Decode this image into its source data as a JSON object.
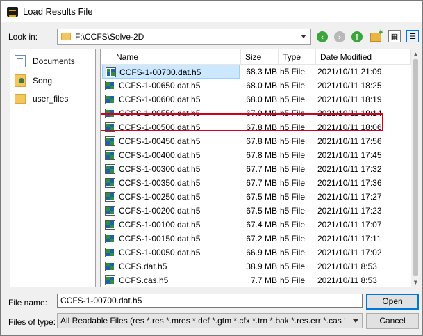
{
  "window": {
    "title": "Load Results File"
  },
  "lookin": {
    "label": "Look in:",
    "path": "F:\\CCFS\\Solve-2D"
  },
  "toolbar": {
    "back_icon": "back-arrow-icon",
    "forward_icon": "forward-arrow-icon",
    "up_icon": "up-arrow-icon",
    "new_folder_icon": "new-folder-icon",
    "list_view_icon": "list-view-icon",
    "detail_view_icon": "detail-view-icon"
  },
  "sidebar": {
    "items": [
      {
        "label": "Documents",
        "icon": "documents-icon"
      },
      {
        "label": "Song",
        "icon": "user-folder-icon"
      },
      {
        "label": "user_files",
        "icon": "folder-icon"
      }
    ]
  },
  "filelist": {
    "columns": [
      "Name",
      "Size",
      "Type",
      "Date Modified"
    ],
    "rows": [
      {
        "name": "CCFS-1-00700.dat.h5",
        "size": "68.3 MB",
        "type": "h5 File",
        "date": "2021/10/11 21:09",
        "selected": true
      },
      {
        "name": "CCFS-1-00650.dat.h5",
        "size": "68.0 MB",
        "type": "h5 File",
        "date": "2021/10/11 18:25"
      },
      {
        "name": "CCFS-1-00600.dat.h5",
        "size": "68.0 MB",
        "type": "h5 File",
        "date": "2021/10/11 18:19"
      },
      {
        "name": "CCFS-1-00550.dat.h5",
        "size": "67.9 MB",
        "type": "h5 File",
        "date": "2021/10/11 18:14"
      },
      {
        "name": "CCFS-1-00500.dat.h5",
        "size": "67.8 MB",
        "type": "h5 File",
        "date": "2021/10/11 18:06"
      },
      {
        "name": "CCFS-1-00450.dat.h5",
        "size": "67.8 MB",
        "type": "h5 File",
        "date": "2021/10/11 17:56"
      },
      {
        "name": "CCFS-1-00400.dat.h5",
        "size": "67.8 MB",
        "type": "h5 File",
        "date": "2021/10/11 17:45"
      },
      {
        "name": "CCFS-1-00300.dat.h5",
        "size": "67.7 MB",
        "type": "h5 File",
        "date": "2021/10/11 17:32"
      },
      {
        "name": "CCFS-1-00350.dat.h5",
        "size": "67.7 MB",
        "type": "h5 File",
        "date": "2021/10/11 17:36"
      },
      {
        "name": "CCFS-1-00250.dat.h5",
        "size": "67.5 MB",
        "type": "h5 File",
        "date": "2021/10/11 17:27"
      },
      {
        "name": "CCFS-1-00200.dat.h5",
        "size": "67.5 MB",
        "type": "h5 File",
        "date": "2021/10/11 17:23"
      },
      {
        "name": "CCFS-1-00100.dat.h5",
        "size": "67.4 MB",
        "type": "h5 File",
        "date": "2021/10/11 17:07"
      },
      {
        "name": "CCFS-1-00150.dat.h5",
        "size": "67.2 MB",
        "type": "h5 File",
        "date": "2021/10/11 17:11"
      },
      {
        "name": "CCFS-1-00050.dat.h5",
        "size": "66.9 MB",
        "type": "h5 File",
        "date": "2021/10/11 17:02"
      },
      {
        "name": "CCFS.dat.h5",
        "size": "38.9 MB",
        "type": "h5 File",
        "date": "2021/10/11 8:53"
      },
      {
        "name": "CCFS.cas.h5",
        "size": "7.7 MB",
        "type": "h5 File",
        "date": "2021/10/11 8:53"
      }
    ]
  },
  "filename": {
    "label": "File name:",
    "value": "CCFS-1-00700.dat.h5",
    "open_label": "Open"
  },
  "filetype": {
    "label": "Files of type:",
    "value": "All Readable Files (res *.res *.mres *.def *.gtm *.cfx *.trn *.bak *.res.err *.cas *.cas.gz",
    "cancel_label": "Cancel"
  },
  "colors": {
    "selection_bg": "#cce8ff",
    "highlight_box": "#d00020",
    "accent": "#0078d7"
  }
}
